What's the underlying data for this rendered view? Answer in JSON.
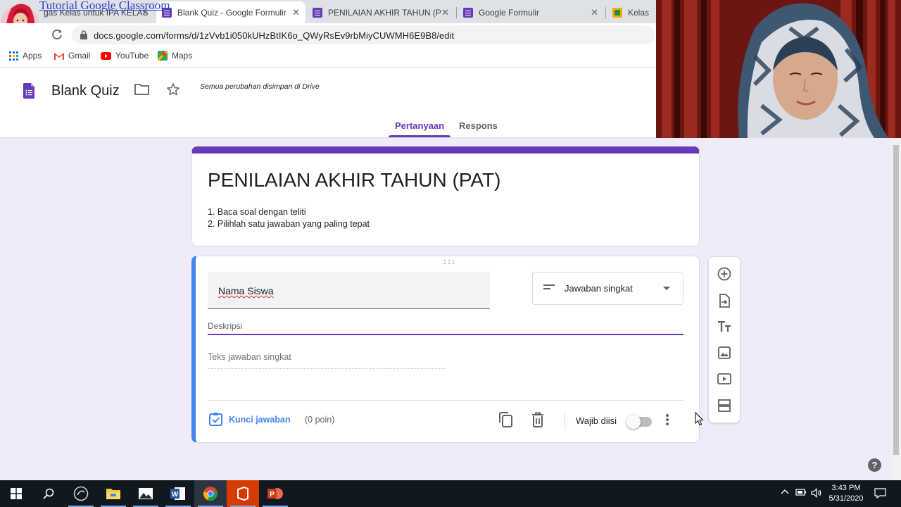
{
  "browser": {
    "tabs": [
      {
        "title": "gas Kelas untuk IPA KELAS",
        "icon": "classroom-icon",
        "active": false
      },
      {
        "title": "Blank Quiz - Google Formulir",
        "icon": "forms-icon",
        "active": true
      },
      {
        "title": "PENILAIAN AKHIR TAHUN (PAT",
        "icon": "forms-icon",
        "active": false
      },
      {
        "title": "Google Formulir",
        "icon": "forms-icon",
        "active": false
      },
      {
        "title": "Kelas",
        "icon": "classroom-icon",
        "active": false
      }
    ],
    "overlay_brand": "Tutorial Google Classroom",
    "url": "docs.google.com/forms/d/1zVvb1i050kUHzBtIK6o_QWyRsEv9rbMiyCUWMH6E9B8/edit",
    "bookmarks": [
      {
        "label": "Apps",
        "icon": "apps-grid-icon"
      },
      {
        "label": "Gmail",
        "icon": "gmail-icon"
      },
      {
        "label": "YouTube",
        "icon": "youtube-icon"
      },
      {
        "label": "Maps",
        "icon": "maps-icon"
      }
    ]
  },
  "forms_header": {
    "doc_title": "Blank Quiz",
    "save_status": "Semua perubahan disimpan di Drive",
    "tabs": {
      "questions": "Pertanyaan",
      "responses": "Respons"
    }
  },
  "form": {
    "title": "PENILAIAN AKHIR TAHUN (PAT)",
    "description": [
      "1. Baca soal dengan teliti",
      "2. Pilihlah satu jawaban yang paling tepat"
    ],
    "question": {
      "text": "Nama Siswa",
      "type": "Jawaban singkat",
      "description_placeholder": "Deskripsi",
      "answer_placeholder": "Teks jawaban singkat",
      "answer_key_label": "Kunci jawaban",
      "points": "(0 poin)",
      "required_label": "Wajib diisi",
      "required": false
    }
  },
  "taskbar": {
    "time": "3:43 PM",
    "date": "5/31/2020"
  },
  "colors": {
    "accent": "#673ab7",
    "question_border": "#4285f4",
    "background": "#f0ebf8"
  }
}
